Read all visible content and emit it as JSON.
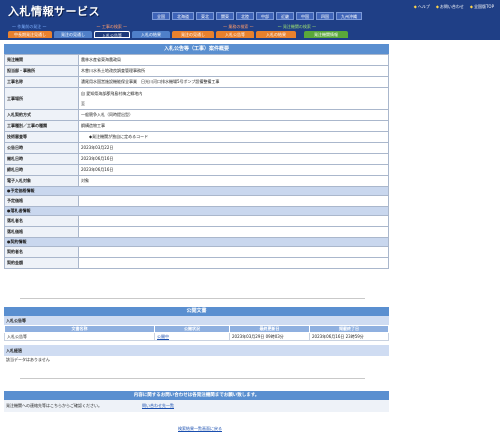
{
  "header": {
    "logo": "入札情報サービス",
    "links": [
      "ヘルプ",
      "お問い合わせ",
      "全国版TOP"
    ],
    "regions": [
      "全国",
      "北海道",
      "東北",
      "関東",
      "北陸",
      "中部",
      "近畿",
      "中国",
      "四国",
      "九州沖縄"
    ],
    "categories": [
      {
        "label": "～ 作業前の発注 ～",
        "color": "#7fb0ff"
      },
      {
        "label": "～ 工事の検索 ～",
        "color": "#ff9a6a"
      },
      {
        "label": "～ 業務の検索 ～",
        "color": "#ff9a6a"
      },
      {
        "label": "～ 発注機関の検索 ～",
        "color": "#9fe070"
      }
    ],
    "tabs": [
      {
        "label": "中長期発注見通し",
        "color": "#e8812e",
        "active": false
      },
      {
        "label": "発注の見通し",
        "color": "#4f7fc9",
        "active": false
      },
      {
        "label": "入札公告等",
        "color": "#1d3a7a",
        "active": true
      },
      {
        "label": "入札の結果",
        "color": "#4f7fc9",
        "active": false
      },
      {
        "label": "発注の見通し",
        "color": "#e8812e",
        "active": false
      },
      {
        "label": "入札公告等",
        "color": "#e8812e",
        "active": false
      },
      {
        "label": "入札の結果",
        "color": "#e8812e",
        "active": false
      },
      {
        "label": "発注機関情報",
        "color": "#5aa83a",
        "active": false
      }
    ]
  },
  "title": "入札公告等（工事）案件概要",
  "fields": [
    {
      "label": "発注機関",
      "value": "農林水産省東海農政局"
    },
    {
      "label": "担当部・事務所",
      "value": "木曽川水系土地改良調査管理事務所"
    },
    {
      "label": "工事名称",
      "value": "濃尾用水国営施設機能保全事業　日光川河口排水機場5号ポンプ設備整備工事"
    },
    {
      "label": "工事場所",
      "value": "自 愛知県海部郡飛島村梅之郷地内",
      "value2": "至"
    },
    {
      "label": "入札契約方式",
      "value": "一般競争入札（同時提出型）"
    },
    {
      "label": "工事種別／工事の種類",
      "value": "鋼構造物工事"
    },
    {
      "label": "技術審査等",
      "value": "　　◆発注機関が独自に定めるコード"
    },
    {
      "label": "公告日時",
      "value": "2023年03月22日"
    },
    {
      "label": "開札日時",
      "value": "2023年06月16日"
    },
    {
      "label": "締札日時",
      "value": "2023年06月16日"
    },
    {
      "label": "電子入札対象",
      "value": "対象"
    }
  ],
  "sections": [
    {
      "title": "●予定価格情報",
      "rows": [
        "予定価格"
      ]
    },
    {
      "title": "●落札者情報",
      "rows": [
        "落札者名",
        "落札価格"
      ]
    },
    {
      "title": "●契約情報",
      "rows": [
        "契約者名",
        "契約金額"
      ]
    }
  ],
  "docs": {
    "band": "公開文書",
    "section": "入札公告等",
    "columns": [
      "文書名称",
      "公開状況",
      "最終更新日",
      "掲載終了日"
    ],
    "rows": [
      [
        "入札公告等",
        "公開中",
        "2023年03月29日 09時03分",
        "2023年06月16日 23時59分"
      ]
    ]
  },
  "results": {
    "section": "入札経過",
    "empty": "該当データはありません"
  },
  "contact": {
    "band": "内容に関するお問い合わせは各発注機関までお願い致します。",
    "text": "発注機関への連絡先等はこちらからご確認ください。",
    "link": "問い合わせ先一覧"
  },
  "footer_link": "検索結果一覧画面に戻る"
}
